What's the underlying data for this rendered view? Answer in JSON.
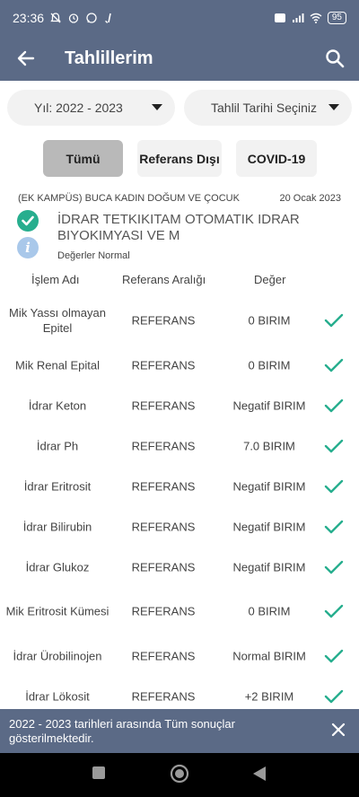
{
  "status_bar": {
    "time": "23:36",
    "battery": "95"
  },
  "app_bar": {
    "title": "Tahlillerim"
  },
  "filters": {
    "year": "Yıl: 2022 - 2023",
    "date": "Tahlil Tarihi Seçiniz"
  },
  "tabs": [
    "Tümü",
    "Referans Dışı",
    "COVID-19"
  ],
  "result": {
    "lab": "(EK KAMPÜS) BUCA KADIN DOĞUM VE ÇOCUK",
    "date": "20 Ocak 2023",
    "test_name": "İDRAR TETKIKITAM OTOMATIK IDRAR BIYOKIMYASI VE M",
    "status_text": "Değerler Normal",
    "info_glyph": "i"
  },
  "table": {
    "headers": [
      "İşlem Adı",
      "Referans Aralığı",
      "Değer"
    ],
    "rows": [
      {
        "name": "Mik Yassı olmayan Epitel",
        "ref": "REFERANS",
        "value": "0 BIRIM"
      },
      {
        "name": "Mik Renal Epital",
        "ref": "REFERANS",
        "value": "0 BIRIM"
      },
      {
        "name": "İdrar Keton",
        "ref": "REFERANS",
        "value": "Negatif BIRIM"
      },
      {
        "name": "İdrar Ph",
        "ref": "REFERANS",
        "value": "7.0 BIRIM"
      },
      {
        "name": "İdrar Eritrosit",
        "ref": "REFERANS",
        "value": "Negatif BIRIM"
      },
      {
        "name": "İdrar Bilirubin",
        "ref": "REFERANS",
        "value": "Negatif BIRIM"
      },
      {
        "name": "İdrar Glukoz",
        "ref": "REFERANS",
        "value": "Negatif BIRIM"
      },
      {
        "name": "Mik Eritrosit Kümesi",
        "ref": "REFERANS",
        "value": "0 BIRIM"
      },
      {
        "name": "İdrar Ürobilinojen",
        "ref": "REFERANS",
        "value": "Normal BIRIM"
      },
      {
        "name": "İdrar Lökosit",
        "ref": "REFERANS",
        "value": "+2 BIRIM"
      }
    ]
  },
  "snackbar": {
    "message": "2022 - 2023 tarihleri arasında Tüm sonuçlar gösterilmektedir."
  },
  "colors": {
    "primary": "#5b6a86",
    "success": "#27ae8e",
    "info": "#a9c8ea",
    "chip_active": "#b9b9b9",
    "chip": "#f2f2f2"
  }
}
